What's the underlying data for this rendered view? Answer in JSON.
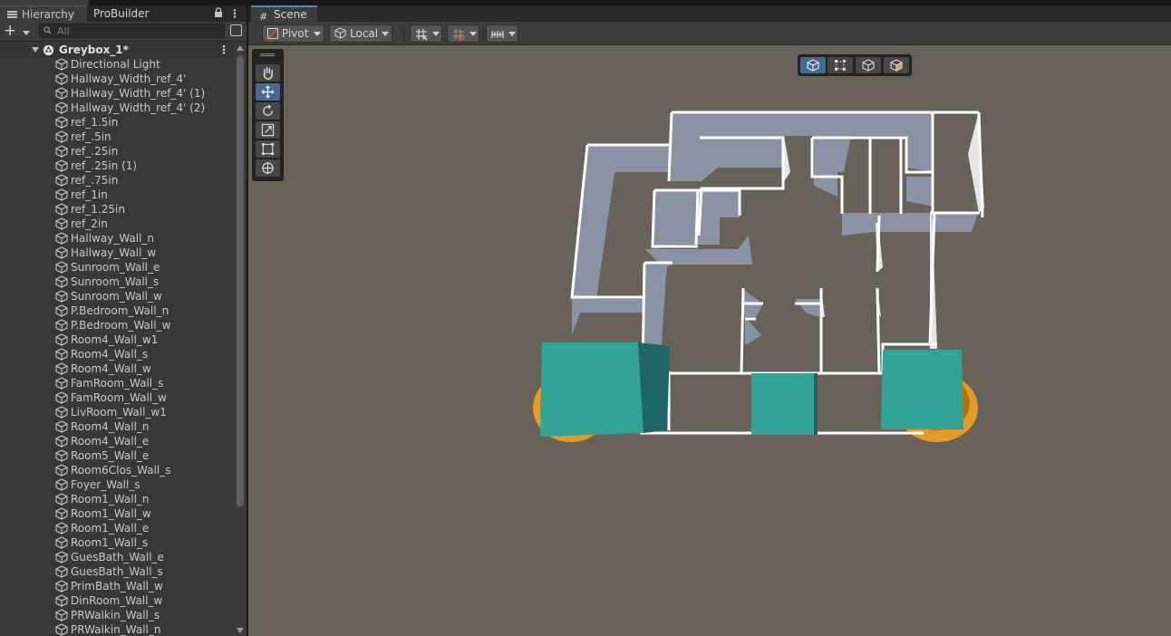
{
  "hierarchy": {
    "tab_label": "Hierarchy",
    "probuilder_tab_label": "ProBuilder",
    "search_placeholder": "All",
    "root": "Greybox_1*",
    "items": [
      "Directional Light",
      "Hallway_Width_ref_4'",
      "Hallway_Width_ref_4' (1)",
      "Hallway_Width_ref_4' (2)",
      "ref_1.5in",
      "ref_.5in",
      "ref_.25in",
      "ref_.25in (1)",
      "ref_.75in",
      "ref_1in",
      "ref_1.25in",
      "ref_2in",
      "Hallway_Wall_n",
      "Hallway_Wall_w",
      "Sunroom_Wall_e",
      "Sunroom_Wall_s",
      "Sunroom_Wall_w",
      "P.Bedroom_Wall_n",
      "P.Bedroom_Wall_w",
      "Room4_Wall_w1",
      "Room4_Wall_s",
      "Room4_Wall_w",
      "FamRoom_Wall_s",
      "FamRoom_Wall_w",
      "LivRoom_Wall_w1",
      "Room4_Wall_n",
      "Room4_Wall_e",
      "Room5_Wall_e",
      "Room6Clos_Wall_s",
      "Foyer_Wall_s",
      "Room1_Wall_n",
      "Room1_Wall_w",
      "Room1_Wall_e",
      "Room1_Wall_s",
      "GuesBath_Wall_e",
      "GuesBath_Wall_s",
      "PrimBath_Wall_w",
      "DinRoom_Wall_w",
      "PRWalkin_Wall_s",
      "PRWalkin_Wall_n"
    ]
  },
  "scene": {
    "tab_label": "Scene",
    "pivot_label": "Pivot",
    "local_label": "Local"
  },
  "colors": {
    "accent": "#496891",
    "viewport": "#696258",
    "wall_top": "#ffffff",
    "wall_side": "#8a93a6",
    "teal": "#32a394",
    "orange": "#e59a2a"
  }
}
